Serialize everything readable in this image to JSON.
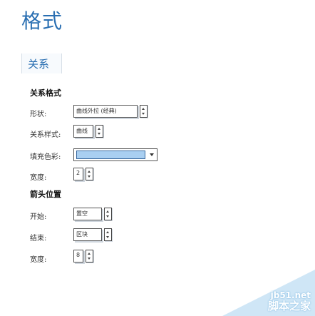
{
  "page": {
    "title": "格式"
  },
  "tab": {
    "label": "关系"
  },
  "relation_format": {
    "heading": "关系格式",
    "shape": {
      "label": "形状:",
      "value": "曲线外拉 (经典)"
    },
    "style": {
      "label": "关系样式:",
      "value": "曲线"
    },
    "fill": {
      "label": "填充色彩:",
      "color": "#a9cff1"
    },
    "width": {
      "label": "宽度:",
      "value": "2"
    }
  },
  "arrow_position": {
    "heading": "箭头位置",
    "start": {
      "label": "开始:",
      "value": "置空"
    },
    "end": {
      "label": "结束:",
      "value": "区块"
    },
    "width": {
      "label": "宽度:",
      "value": "8"
    }
  },
  "watermark": {
    "site": "jb51.net",
    "name": "脚本之家"
  }
}
